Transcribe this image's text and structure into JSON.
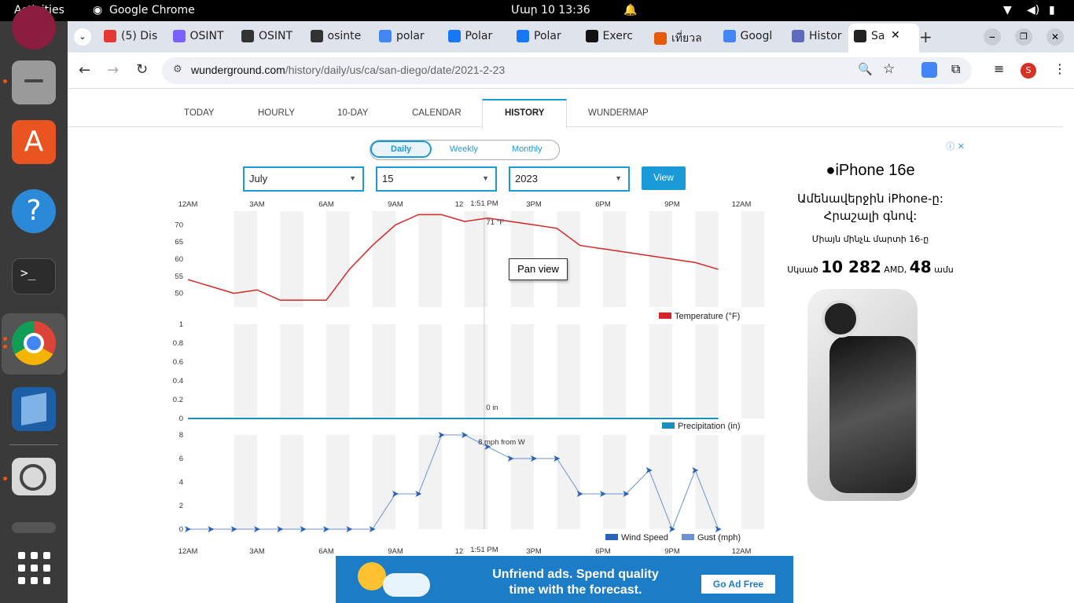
{
  "system": {
    "activities": "Activities",
    "app_name": "Google Chrome",
    "clock": "Մար 10  13:36"
  },
  "browser": {
    "tabs": [
      {
        "label": "(5) Dis",
        "color": "#e53935"
      },
      {
        "label": "OSINT",
        "color": "#7b61ff"
      },
      {
        "label": "OSINT",
        "color": "#333"
      },
      {
        "label": "osinte",
        "color": "#333"
      },
      {
        "label": "polar",
        "color": "#4285f4"
      },
      {
        "label": "Polar",
        "color": "#1877f2"
      },
      {
        "label": "Polar",
        "color": "#1877f2"
      },
      {
        "label": "Exerc",
        "color": "#111"
      },
      {
        "label": "เที่ยวล",
        "color": "#e8590c"
      },
      {
        "label": "Googl",
        "color": "#4285f4"
      },
      {
        "label": "Histor",
        "color": "#5c6bc0"
      },
      {
        "label": "Sa",
        "color": "#222"
      }
    ],
    "url_domain": "wunderground.com",
    "url_path": "/history/daily/us/ca/san-diego/date/2021-2-23",
    "profile_initial": "S"
  },
  "page": {
    "nav_tabs": [
      "TODAY",
      "HOURLY",
      "10-DAY",
      "CALENDAR",
      "HISTORY",
      "WUNDERMAP"
    ],
    "period_tabs": [
      "Daily",
      "Weekly",
      "Monthly"
    ],
    "month": "July",
    "day": "15",
    "year": "2023",
    "view_button": "View",
    "tooltip": "Pan view",
    "crosshair_time": "1:51 PM",
    "ad_banner": {
      "line1": "Unfriend ads. Spend quality",
      "line2": "time with the forecast.",
      "button": "Go Ad Free"
    }
  },
  "side_ad": {
    "brand": "iPhone 16e",
    "headline1": "Ամենավերջին iPhone-ը:",
    "headline2": "Հրաշալի գնով:",
    "sub": "Միայն մինչև մարտի 16-ը",
    "price_prefix": "Սկսած",
    "price": "10 282",
    "currency": "AMD,",
    "months": "48",
    "months_suffix": "ամս"
  },
  "chart_data": [
    {
      "type": "line",
      "title": "",
      "x": [
        "1AM",
        "2AM",
        "3AM",
        "4AM",
        "5AM",
        "6AM",
        "7AM",
        "8AM",
        "9AM",
        "10AM",
        "11AM",
        "12PM",
        "1PM",
        "2PM",
        "3PM",
        "4PM",
        "5PM",
        "6PM",
        "7PM",
        "8PM",
        "9PM",
        "10PM",
        "11PM",
        "12AM",
        "1AM"
      ],
      "series": [
        {
          "name": "Temperature (°F)",
          "values": [
            54,
            52,
            50,
            51,
            48,
            48,
            48,
            57,
            64,
            70,
            73,
            73,
            71,
            72,
            71,
            70,
            69,
            64,
            63,
            62,
            61,
            60,
            59,
            57,
            null
          ],
          "color": "#d62728"
        }
      ],
      "x_ticks": [
        "12AM",
        "3AM",
        "6AM",
        "9AM",
        "12PM",
        "3PM",
        "6PM",
        "9PM",
        "12AM"
      ],
      "y_ticks": [
        50,
        55,
        60,
        65,
        70
      ],
      "ylim": [
        46,
        74
      ],
      "annotation": "71 °F"
    },
    {
      "type": "area",
      "title": "",
      "series": [
        {
          "name": "Precipitation (in)",
          "values": [
            0,
            0,
            0,
            0,
            0,
            0,
            0,
            0,
            0,
            0,
            0,
            0,
            0,
            0,
            0,
            0,
            0,
            0,
            0,
            0,
            0,
            0,
            0,
            0,
            0
          ],
          "color": "#1a8fbf"
        }
      ],
      "y_ticks": [
        0,
        0.2,
        0.4,
        0.6,
        0.8,
        1
      ],
      "ylim": [
        0,
        1
      ],
      "annotation": "0 in"
    },
    {
      "type": "line",
      "title": "",
      "series": [
        {
          "name": "Wind Speed",
          "values": [
            0,
            0,
            0,
            0,
            0,
            0,
            0,
            0,
            0,
            3,
            3,
            8,
            8,
            7,
            6,
            6,
            6,
            3,
            3,
            3,
            5,
            0,
            5,
            0,
            null
          ],
          "color": "#2a63b8"
        },
        {
          "name": "Gust (mph)",
          "values": [],
          "color": "#6b94d0"
        }
      ],
      "y_ticks": [
        0,
        2,
        4,
        6,
        8
      ],
      "ylim": [
        0,
        8
      ],
      "annotation": "8 mph from W"
    }
  ]
}
